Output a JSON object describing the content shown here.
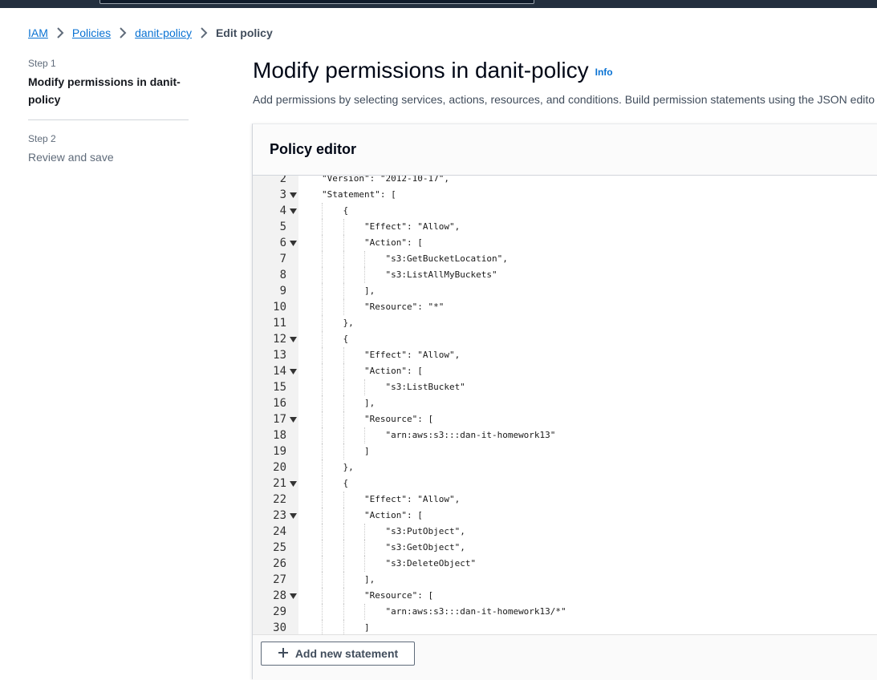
{
  "breadcrumb": {
    "items": [
      "IAM",
      "Policies",
      "danit-policy"
    ],
    "current": "Edit policy"
  },
  "steps": [
    {
      "label": "Step 1",
      "title": "Modify permissions in danit-policy"
    },
    {
      "label": "Step 2",
      "title": "Review and save"
    }
  ],
  "page": {
    "title": "Modify permissions in danit-policy",
    "info": "Info",
    "description": "Add permissions by selecting services, actions, resources, and conditions. Build permission statements using the JSON edito"
  },
  "editor": {
    "title": "Policy editor",
    "lines": [
      {
        "n": "2",
        "fold": false,
        "indent": 0,
        "text": "\"Version\": \"2012-10-17\","
      },
      {
        "n": "3",
        "fold": true,
        "indent": 0,
        "text": "\"Statement\": ["
      },
      {
        "n": "4",
        "fold": true,
        "indent": 1,
        "text": "{"
      },
      {
        "n": "5",
        "fold": false,
        "indent": 2,
        "text": "\"Effect\": \"Allow\","
      },
      {
        "n": "6",
        "fold": true,
        "indent": 2,
        "text": "\"Action\": ["
      },
      {
        "n": "7",
        "fold": false,
        "indent": 3,
        "text": "\"s3:GetBucketLocation\","
      },
      {
        "n": "8",
        "fold": false,
        "indent": 3,
        "text": "\"s3:ListAllMyBuckets\""
      },
      {
        "n": "9",
        "fold": false,
        "indent": 2,
        "text": "],"
      },
      {
        "n": "10",
        "fold": false,
        "indent": 2,
        "text": "\"Resource\": \"*\""
      },
      {
        "n": "11",
        "fold": false,
        "indent": 1,
        "text": "},"
      },
      {
        "n": "12",
        "fold": true,
        "indent": 1,
        "text": "{"
      },
      {
        "n": "13",
        "fold": false,
        "indent": 2,
        "text": "\"Effect\": \"Allow\","
      },
      {
        "n": "14",
        "fold": true,
        "indent": 2,
        "text": "\"Action\": ["
      },
      {
        "n": "15",
        "fold": false,
        "indent": 3,
        "text": "\"s3:ListBucket\""
      },
      {
        "n": "16",
        "fold": false,
        "indent": 2,
        "text": "],"
      },
      {
        "n": "17",
        "fold": true,
        "indent": 2,
        "text": "\"Resource\": ["
      },
      {
        "n": "18",
        "fold": false,
        "indent": 3,
        "text": "\"arn:aws:s3:::dan-it-homework13\""
      },
      {
        "n": "19",
        "fold": false,
        "indent": 2,
        "text": "]"
      },
      {
        "n": "20",
        "fold": false,
        "indent": 1,
        "text": "},"
      },
      {
        "n": "21",
        "fold": true,
        "indent": 1,
        "text": "{"
      },
      {
        "n": "22",
        "fold": false,
        "indent": 2,
        "text": "\"Effect\": \"Allow\","
      },
      {
        "n": "23",
        "fold": true,
        "indent": 2,
        "text": "\"Action\": ["
      },
      {
        "n": "24",
        "fold": false,
        "indent": 3,
        "text": "\"s3:PutObject\","
      },
      {
        "n": "25",
        "fold": false,
        "indent": 3,
        "text": "\"s3:GetObject\","
      },
      {
        "n": "26",
        "fold": false,
        "indent": 3,
        "text": "\"s3:DeleteObject\""
      },
      {
        "n": "27",
        "fold": false,
        "indent": 2,
        "text": "],"
      },
      {
        "n": "28",
        "fold": true,
        "indent": 2,
        "text": "\"Resource\": ["
      },
      {
        "n": "29",
        "fold": false,
        "indent": 3,
        "text": "\"arn:aws:s3:::dan-it-homework13/*\""
      },
      {
        "n": "30",
        "fold": false,
        "indent": 2,
        "text": "]"
      }
    ],
    "add_button": "Add new statement"
  },
  "colors": {
    "link": "#0972d3",
    "topbar": "#232f3e",
    "gutter": "#f2f2f2"
  }
}
